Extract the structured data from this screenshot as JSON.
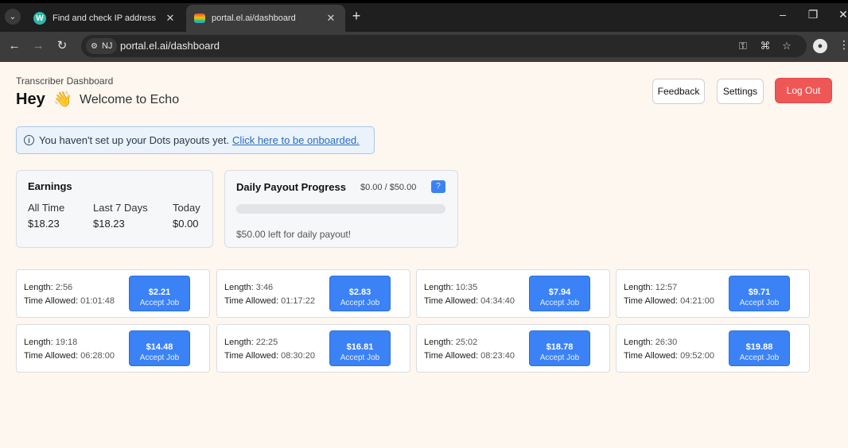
{
  "browser": {
    "tabs": [
      {
        "title": "Find and check IP address",
        "active": false
      },
      {
        "title": "portal.el.ai/dashboard",
        "active": true
      }
    ],
    "site_chip": "NJ",
    "url": "portal.el.ai/dashboard"
  },
  "header": {
    "subtitle": "Transcriber Dashboard",
    "greeting": "Hey",
    "wave": "👋",
    "welcome": "Welcome to Echo",
    "feedback_label": "Feedback",
    "settings_label": "Settings",
    "logout_label": "Log Out"
  },
  "alert": {
    "message": "You haven't set up your Dots payouts yet.",
    "link_text": "Click here to be onboarded."
  },
  "earnings": {
    "title": "Earnings",
    "columns": [
      {
        "label": "All Time",
        "value": "$18.23"
      },
      {
        "label": "Last 7 Days",
        "value": "$18.23"
      },
      {
        "label": "Today",
        "value": "$0.00"
      }
    ]
  },
  "daily_payout": {
    "title": "Daily Payout Progress",
    "amount": "$0.00 / $50.00",
    "help_label": "?",
    "progress_fraction": 0.0,
    "left_text": "$50.00 left for daily payout!"
  },
  "jobs": {
    "length_label": "Length:",
    "time_label": "Time Allowed:",
    "accept_label": "Accept Job",
    "items": [
      {
        "length": "2:56",
        "time_allowed": "01:01:48",
        "price": "$2.21"
      },
      {
        "length": "3:46",
        "time_allowed": "01:17:22",
        "price": "$2.83"
      },
      {
        "length": "10:35",
        "time_allowed": "04:34:40",
        "price": "$7.94"
      },
      {
        "length": "12:57",
        "time_allowed": "04:21:00",
        "price": "$9.71"
      },
      {
        "length": "19:18",
        "time_allowed": "06:28:00",
        "price": "$14.48"
      },
      {
        "length": "22:25",
        "time_allowed": "08:30:20",
        "price": "$16.81"
      },
      {
        "length": "25:02",
        "time_allowed": "08:23:40",
        "price": "$18.78"
      },
      {
        "length": "26:30",
        "time_allowed": "09:52:00",
        "price": "$19.88"
      }
    ]
  },
  "colors": {
    "accent": "#3b82f6",
    "logout": "#ef5757"
  }
}
